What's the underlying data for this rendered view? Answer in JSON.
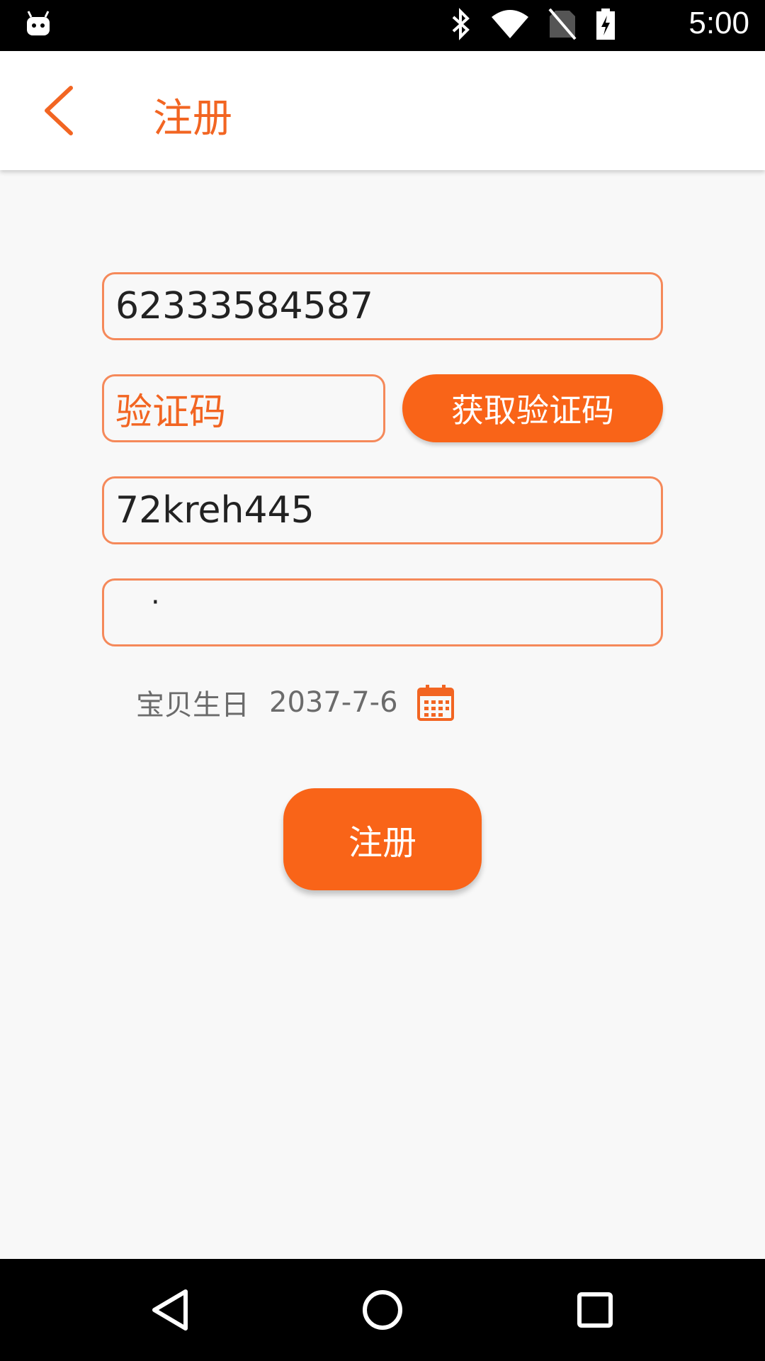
{
  "status_bar": {
    "time": "5:00",
    "icons": [
      "android-icon",
      "bluetooth-icon",
      "wifi-icon",
      "no-sim-icon",
      "battery-charging-icon"
    ]
  },
  "app_bar": {
    "title": "注册",
    "back_icon": "chevron-left-icon"
  },
  "form": {
    "phone_value": "62333584587",
    "code_placeholder": "验证码",
    "get_code_label": "获取验证码",
    "password_value": "72kreh445",
    "confirm_value": "·",
    "birthday_label": "宝贝生日",
    "birthday_value": "2037-7-6",
    "calendar_icon": "calendar-icon",
    "submit_label": "注册"
  },
  "colors": {
    "accent": "#f96418",
    "field_border": "#f5895a",
    "background": "#f8f8f8"
  },
  "nav_bar": {
    "icons": [
      "back-triangle-icon",
      "home-circle-icon",
      "recents-square-icon"
    ]
  }
}
